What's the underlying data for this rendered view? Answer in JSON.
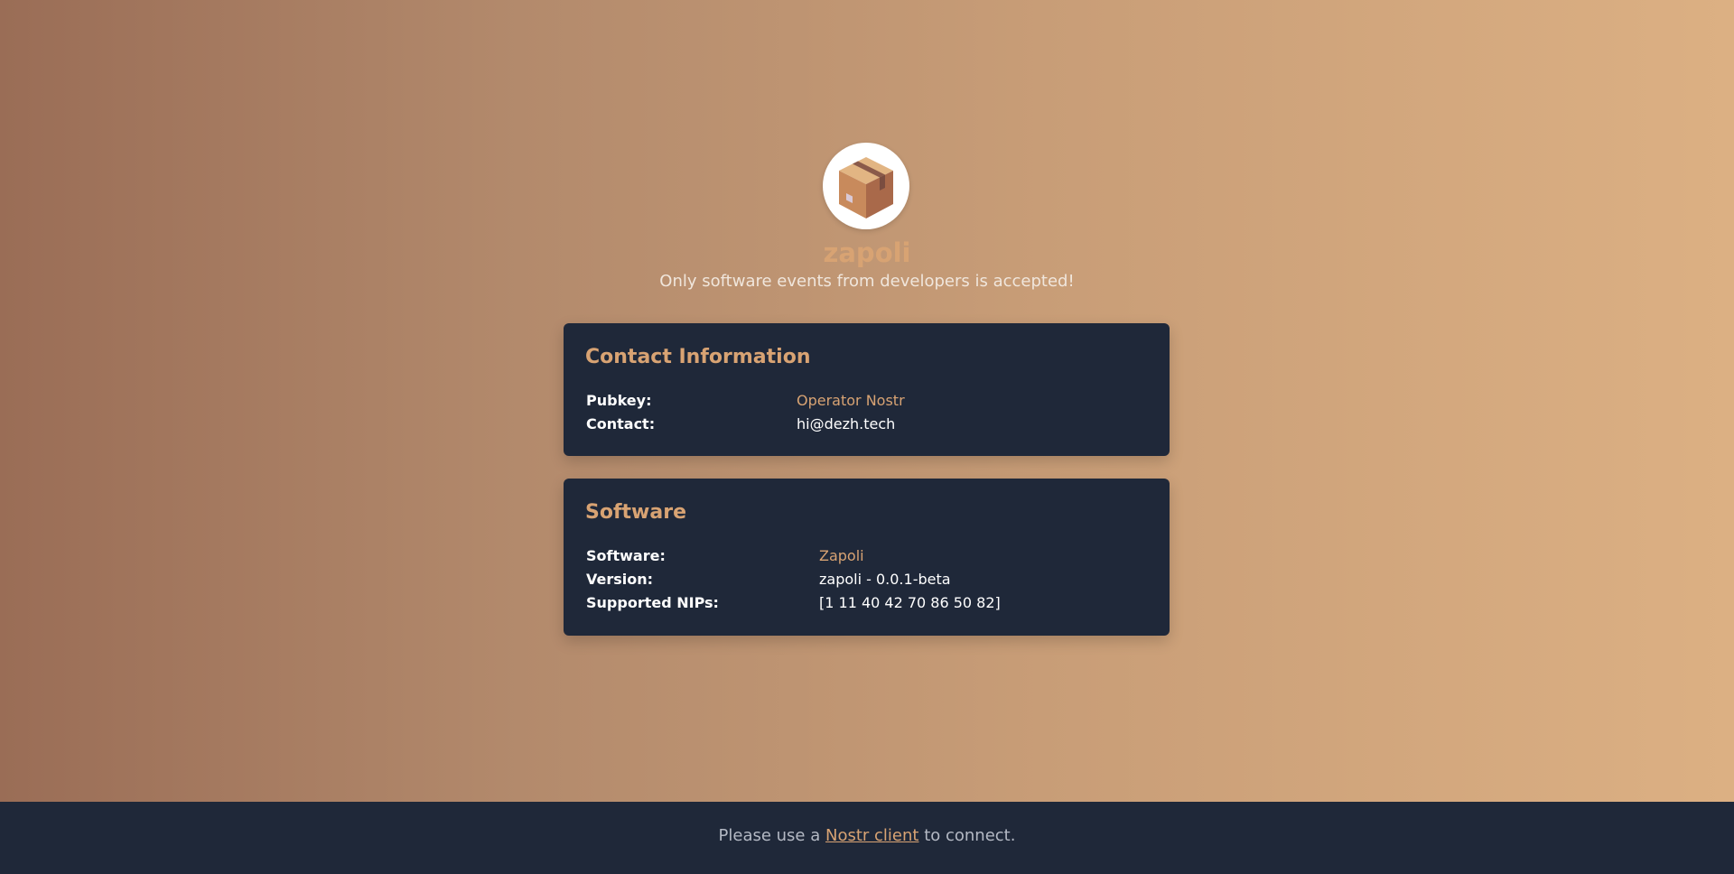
{
  "relay": {
    "name": "zapoli",
    "description": "Only software events from developers is accepted!",
    "logo_icon": "package-box-icon"
  },
  "contact": {
    "title": "Contact Information",
    "pubkey_label": "Pubkey:",
    "pubkey_value": "Operator Nostr",
    "contact_label": "Contact:",
    "contact_value": "hi@dezh.tech"
  },
  "software": {
    "title": "Software",
    "software_label": "Software:",
    "software_value": "Zapoli",
    "version_label": "Version:",
    "version_value": "zapoli - 0.0.1-beta",
    "nips_label": "Supported NIPs:",
    "nips_value": "[1 11 40 42 70 86 50 82]"
  },
  "footer": {
    "prefix": "Please use a ",
    "link_text": "Nostr client",
    "suffix": " to connect."
  },
  "colors": {
    "accent": "#d8a373",
    "card_bg": "#1f2839",
    "footer_bg": "#1f2839",
    "gradient_start": "#9a6d56",
    "gradient_end": "#dcb083"
  }
}
